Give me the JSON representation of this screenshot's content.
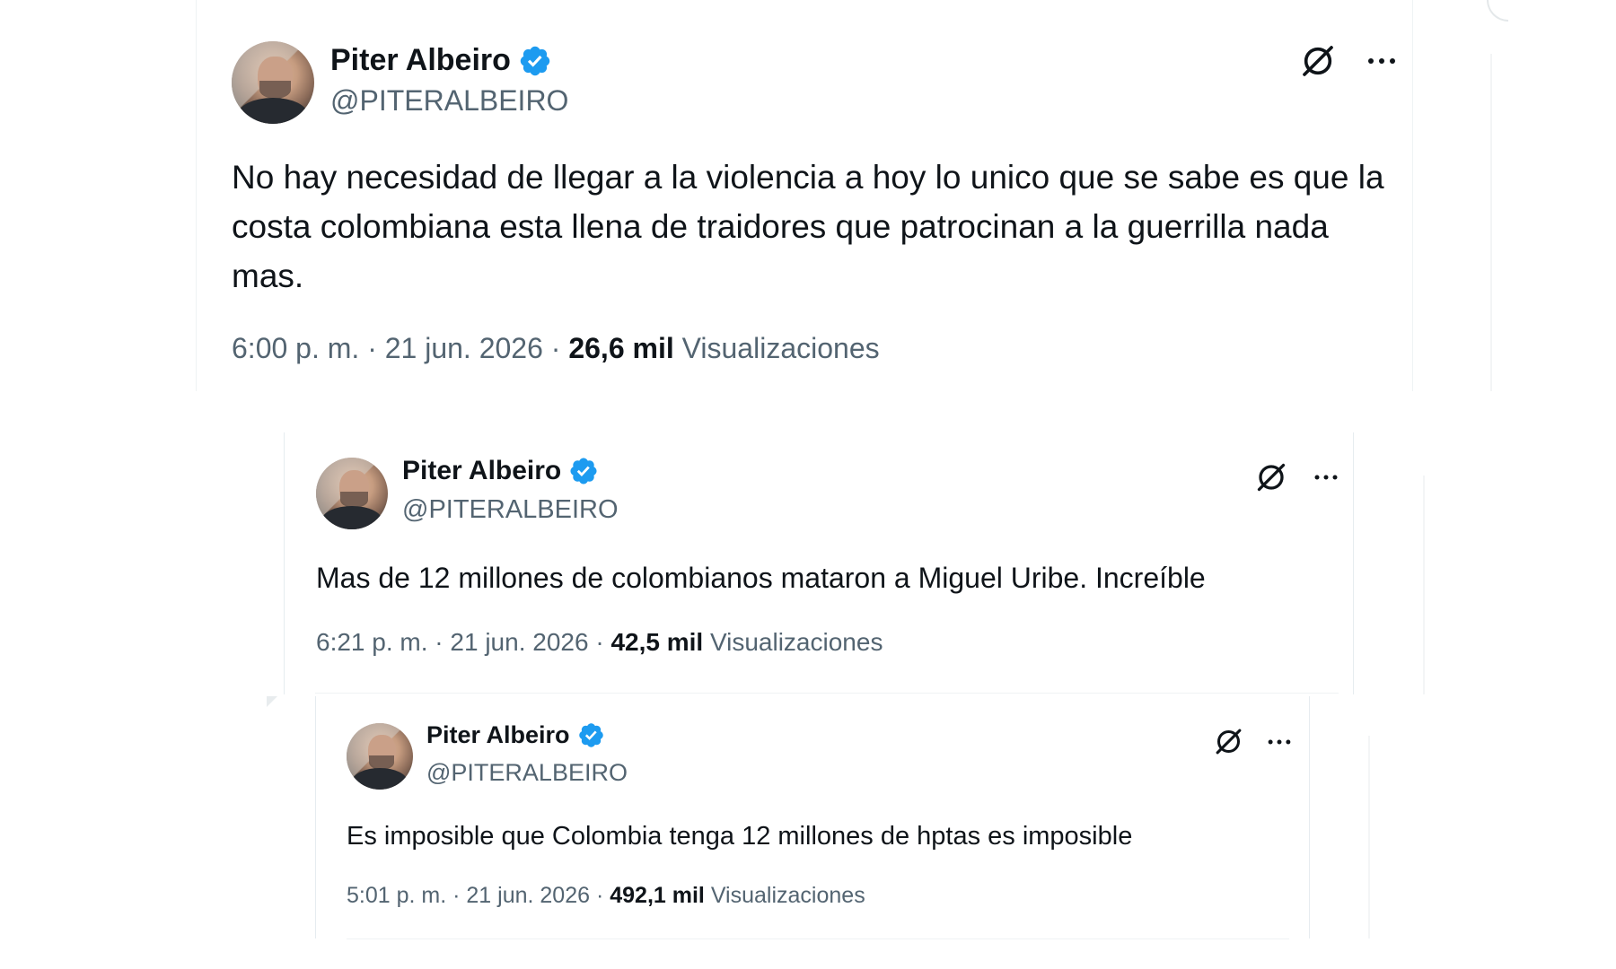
{
  "tweets": [
    {
      "author_name": "Piter Albeiro",
      "handle": "@PITERALBEIRO",
      "text": "No hay necesidad de llegar a la violencia a hoy lo unico que se sabe es que la costa colombiana esta llena de traidores que patrocinan a la guerrilla nada mas.",
      "time": "6:00 p. m.",
      "date": "21 jun. 2026",
      "views_count": "26,6 mil",
      "views_label": "Visualizaciones"
    },
    {
      "author_name": "Piter Albeiro",
      "handle": "@PITERALBEIRO",
      "text": "Mas de 12 millones de colombianos mataron a Miguel Uribe. Increíble",
      "time": "6:21 p. m.",
      "date": "21 jun. 2026",
      "views_count": "42,5 mil",
      "views_label": "Visualizaciones"
    },
    {
      "author_name": "Piter Albeiro",
      "handle": "@PITERALBEIRO",
      "text": "Es imposible que Colombia tenga 12 millones de hptas es imposible",
      "time": "5:01 p. m.",
      "date": "21 jun. 2026",
      "views_count": "492,1 mil",
      "views_label": "Visualizaciones"
    }
  ],
  "meta_separator": " · ",
  "icons": {
    "verified": "verified-badge-icon",
    "grok": "grok-icon",
    "more": "more-options-icon"
  },
  "colors": {
    "verified_blue": "#1d9bf0",
    "text_primary": "#0f1419",
    "text_secondary": "#536471",
    "divider": "#eff3f4"
  }
}
